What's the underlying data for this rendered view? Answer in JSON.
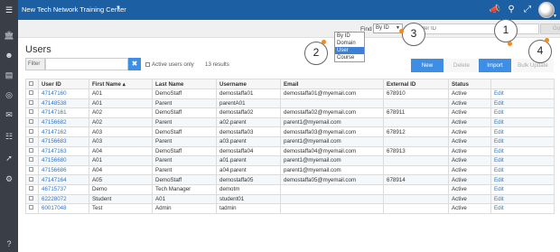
{
  "app": {
    "title": "New Tech Network Training Center",
    "menu_icon": "hamburger-icon"
  },
  "topbar_icons": [
    "megaphone-icon",
    "search-icon",
    "expand-icon"
  ],
  "sidebar_icons": [
    "home-icon",
    "users-icon",
    "book-icon",
    "target-icon",
    "mail-icon",
    "clipboard-icon",
    "chart-icon",
    "settings-icon",
    "help-icon"
  ],
  "find": {
    "label": "Find",
    "selected": "By ID",
    "options": [
      "By ID",
      "Domain",
      "User",
      "Course"
    ],
    "highlighted": "User",
    "placeholder": "Enter ID",
    "go_label": "Go"
  },
  "callouts": [
    "1",
    "2",
    "3",
    "4"
  ],
  "page": {
    "title": "Users"
  },
  "toolbar": {
    "filter_label": "Filter",
    "active_only_label": "Active users only",
    "results_text": "13 results",
    "new_label": "New",
    "delete_label": "Delete",
    "import_label": "Import",
    "bulk_label": "Bulk Update"
  },
  "table": {
    "headers": [
      "User ID",
      "First Name ▴",
      "Last Name",
      "Username",
      "Email",
      "External ID",
      "Status",
      ""
    ],
    "rows": [
      [
        "47147160",
        "A01",
        "DemoStaff",
        "demostaffa01",
        "demostaffa01@myemail.com",
        "678910",
        "Active",
        "Edit"
      ],
      [
        "47148538",
        "A01",
        "Parent",
        "parentA01",
        "",
        "",
        "Active",
        "Edit"
      ],
      [
        "47147161",
        "A02",
        "DemoStaff",
        "demostaffa02",
        "demostaffa02@myemail.com",
        "678911",
        "Active",
        "Edit"
      ],
      [
        "47156682",
        "A02",
        "Parent",
        "a02.parent",
        "parent1@myemail.com",
        "",
        "Active",
        "Edit"
      ],
      [
        "47147162",
        "A03",
        "DemoStaff",
        "demostaffa03",
        "demostaffa03@myemail.com",
        "678912",
        "Active",
        "Edit"
      ],
      [
        "47156683",
        "A03",
        "Parent",
        "a03.parent",
        "parent1@myemail.com",
        "",
        "Active",
        "Edit"
      ],
      [
        "47147163",
        "A04",
        "DemoStaff",
        "demostaffa04",
        "demostaffa04@myemail.com",
        "678913",
        "Active",
        "Edit"
      ],
      [
        "47156680",
        "A01",
        "Parent",
        "a01.parent",
        "parent1@myemail.com",
        "",
        "Active",
        "Edit"
      ],
      [
        "47156686",
        "A04",
        "Parent",
        "a04.parent",
        "parent1@myemail.com",
        "",
        "Active",
        "Edit"
      ],
      [
        "47147164",
        "A05",
        "DemoStaff",
        "demostaffa05",
        "demostaffa05@myemail.com",
        "678914",
        "Active",
        "Edit"
      ],
      [
        "46715737",
        "Demo",
        "Tech Manager",
        "demotm",
        "",
        "",
        "Active",
        "Edit"
      ],
      [
        "62228072",
        "Student",
        "A01",
        "student01",
        "",
        "",
        "Active",
        "Edit"
      ],
      [
        "60017048",
        "Test",
        "Admin",
        "tadmin",
        "",
        "",
        "Active",
        "Edit"
      ]
    ]
  },
  "colors": {
    "topbar": "#1d5fa3",
    "sidebar": "#3a3f47",
    "accent": "#3d8ee4",
    "link": "#2f77c7",
    "callout_dot": "#f28b1f"
  }
}
